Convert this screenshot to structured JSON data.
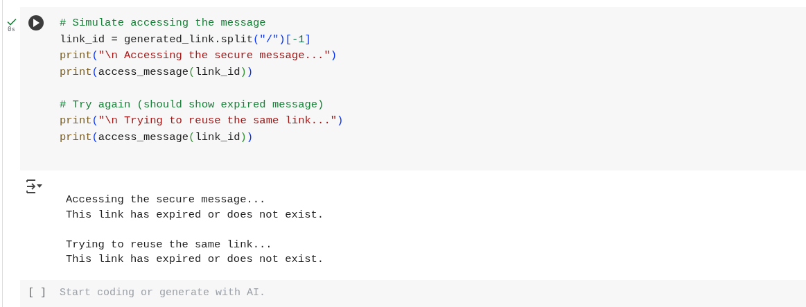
{
  "code_cell": {
    "status": {
      "done": true,
      "time": "0s"
    },
    "blocks": [
      [
        [
          {
            "kind": "comment",
            "text": "# Simulate accessing the message"
          }
        ],
        [
          {
            "kind": "plain",
            "text": "link_id = generated_link.split"
          },
          {
            "kind": "bracket",
            "text": "(\"/\")"
          },
          {
            "kind": "bracket",
            "text": "["
          },
          {
            "kind": "number",
            "text": "-1"
          },
          {
            "kind": "bracket",
            "text": "]"
          }
        ],
        [
          {
            "kind": "func",
            "text": "print"
          },
          {
            "kind": "bracket",
            "text": "("
          },
          {
            "kind": "string",
            "text": "\"\\n Accessing the secure message...\""
          },
          {
            "kind": "bracket",
            "text": ")"
          }
        ],
        [
          {
            "kind": "func",
            "text": "print"
          },
          {
            "kind": "bracket",
            "text": "("
          },
          {
            "kind": "plain",
            "text": "access_message"
          },
          {
            "kind": "bracket2",
            "text": "("
          },
          {
            "kind": "plain",
            "text": "link_id"
          },
          {
            "kind": "bracket2",
            "text": ")"
          },
          {
            "kind": "bracket",
            "text": ")"
          }
        ]
      ],
      [
        [
          {
            "kind": "comment",
            "text": "# Try again (should show expired message)"
          }
        ],
        [
          {
            "kind": "func",
            "text": "print"
          },
          {
            "kind": "bracket",
            "text": "("
          },
          {
            "kind": "string",
            "text": "\"\\n Trying to reuse the same link...\""
          },
          {
            "kind": "bracket",
            "text": ")"
          }
        ],
        [
          {
            "kind": "func",
            "text": "print"
          },
          {
            "kind": "bracket",
            "text": "("
          },
          {
            "kind": "plain",
            "text": "access_message"
          },
          {
            "kind": "bracket2",
            "text": "("
          },
          {
            "kind": "plain",
            "text": "link_id"
          },
          {
            "kind": "bracket2",
            "text": ")"
          },
          {
            "kind": "bracket",
            "text": ")"
          }
        ]
      ]
    ]
  },
  "output": {
    "blocks": [
      [
        "Accessing the secure message...",
        "This link has expired or does not exist."
      ],
      [
        "Trying to reuse the same link...",
        "This link has expired or does not exist."
      ]
    ]
  },
  "empty_cell": {
    "brackets": "[ ]",
    "placeholder": "Start coding or generate with AI."
  }
}
